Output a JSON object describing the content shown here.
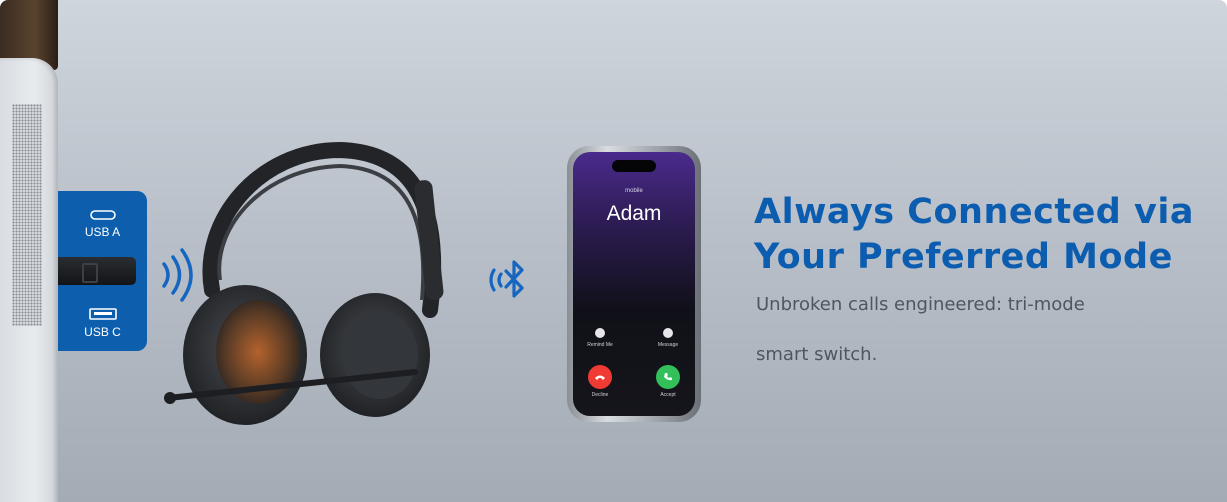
{
  "ports": {
    "top_label": "USB A",
    "bottom_label": "USB C"
  },
  "headline": {
    "line1": "Always Connected via",
    "line2": "Your Preferred Mode"
  },
  "subtext": {
    "line1": "Unbroken calls engineered: tri-mode",
    "line2": "smart switch."
  },
  "phone": {
    "carrier": "mobile",
    "caller_name": "Adam",
    "remind_label": "Remind Me",
    "message_label": "Message",
    "decline_label": "Decline",
    "accept_label": "Accept"
  },
  "icons": {
    "usb_c_port": "usb-c-port-icon",
    "usb_a_port": "usb-a-port-icon",
    "wireless_waves": "wireless-signal-icon",
    "bluetooth": "bluetooth-icon",
    "decline": "phone-hangup-icon",
    "accept": "phone-answer-icon"
  },
  "colors": {
    "brand_blue": "#0c5db0",
    "subtext_gray": "#4e5660",
    "decline_red": "#ef3b34",
    "accept_green": "#33c05a"
  }
}
